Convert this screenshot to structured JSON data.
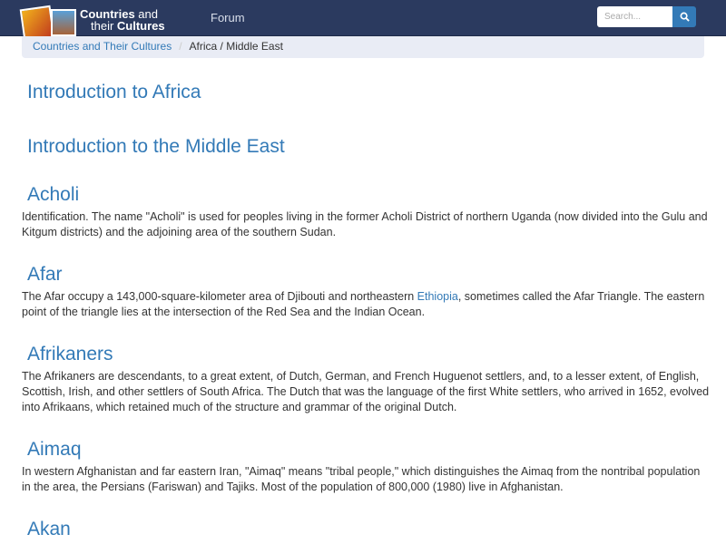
{
  "header": {
    "logo_line1_bold": "Countries",
    "logo_line1_rest": " and",
    "logo_line2_rest": "their ",
    "logo_line2_bold": "Cultures",
    "forum": "Forum",
    "search_placeholder": "Search..."
  },
  "breadcrumb": {
    "home": "Countries and Their Cultures",
    "separator": "/",
    "current": "Africa / Middle East"
  },
  "intros": [
    "Introduction to Africa",
    "Introduction to the Middle East"
  ],
  "entries": [
    {
      "title": "Acholi",
      "text": "Identification. The name \"Acholi\" is used for peoples living in the former Acholi District of northern Uganda (now divided into the Gulu and Kitgum districts) and the adjoining area of the southern Sudan."
    },
    {
      "title": "Afar",
      "text_before": "The Afar occupy a 143,000-square-kilometer area of Djibouti and northeastern ",
      "link": "Ethiopia",
      "text_after": ", sometimes called the Afar Triangle. The eastern point of the triangle lies at the intersection of the Red Sea and the Indian Ocean."
    },
    {
      "title": "Afrikaners",
      "text": "The Afrikaners are descendants, to a great extent, of Dutch, German, and French Huguenot settlers, and, to a lesser extent, of English, Scottish, Irish, and other settlers of South Africa. The Dutch that was the language of the first White settlers, who arrived in 1652, evolved into Afrikaans, which retained much of the structure and grammar of the original Dutch."
    },
    {
      "title": "Aimaq",
      "text": "In western Afghanistan and far eastern Iran, \"Aimaq\" means \"tribal people,\" which distinguishes the Aimaq from the nontribal population in the area, the Persians (Fariswan) and Tajiks. Most of the population of 800,000 (1980) live in Afghanistan."
    },
    {
      "title": "Akan"
    }
  ],
  "colors": {
    "header": "#2b3a5f",
    "link": "#337ab7",
    "breadcrumb_bg": "#e9ecf5"
  },
  "icons": {
    "search": "search-icon"
  }
}
